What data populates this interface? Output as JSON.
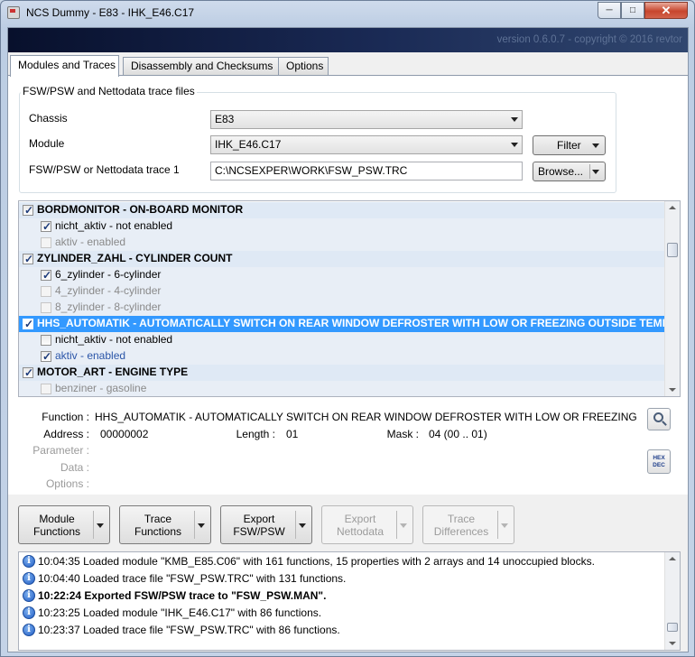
{
  "window": {
    "title": "NCS Dummy - E83 - IHK_E46.C17",
    "minimize_glyph": "─",
    "maximize_glyph": "□",
    "close_glyph": "✕"
  },
  "banner": {
    "version": "version 0.6.0.7 - copyright © 2016 revtor"
  },
  "tabs": [
    {
      "label": "Modules and Traces",
      "active": true
    },
    {
      "label": "Disassembly and Checksums",
      "active": false
    },
    {
      "label": "Options",
      "active": false
    }
  ],
  "files": {
    "group_title": "FSW/PSW and Nettodata trace files",
    "chassis_label": "Chassis",
    "chassis_value": "E83",
    "module_label": "Module",
    "module_value": "IHK_E46.C17",
    "trace_label": "FSW/PSW or Nettodata trace 1",
    "trace_value": "C:\\NCSEXPER\\WORK\\FSW_PSW.TRC",
    "filter_label": "Filter",
    "browse_label": "Browse..."
  },
  "functions": [
    {
      "kind": "group",
      "checked": true,
      "text": "BORDMONITOR  -  ON-BOARD MONITOR"
    },
    {
      "kind": "child",
      "checked": true,
      "dim": false,
      "text": "nicht_aktiv  -  not enabled"
    },
    {
      "kind": "child",
      "checked": false,
      "dim": true,
      "text": "aktiv  -  enabled"
    },
    {
      "kind": "group",
      "checked": true,
      "text": "ZYLINDER_ZAHL  -  CYLINDER COUNT"
    },
    {
      "kind": "child",
      "checked": true,
      "dim": false,
      "text": "6_zylinder  -  6-cylinder"
    },
    {
      "kind": "child",
      "checked": false,
      "dim": true,
      "text": "4_zylinder  -  4-cylinder"
    },
    {
      "kind": "child",
      "checked": false,
      "dim": true,
      "text": "8_zylinder  -  8-cylinder"
    },
    {
      "kind": "group",
      "checked": true,
      "selected": true,
      "text": "HHS_AUTOMATIK  -  AUTOMATICALLY SWITCH ON REAR WINDOW DEFROSTER WITH LOW OR FREEZING OUTSIDE TEMPERA"
    },
    {
      "kind": "child",
      "checked": false,
      "dim": false,
      "text": "nicht_aktiv  -  not enabled"
    },
    {
      "kind": "child",
      "checked": true,
      "dim": false,
      "blue": true,
      "text": "aktiv  -  enabled"
    },
    {
      "kind": "group",
      "checked": true,
      "text": "MOTOR_ART  -  ENGINE TYPE"
    },
    {
      "kind": "child",
      "checked": false,
      "dim": true,
      "text": "benziner  -  gasoline"
    }
  ],
  "details": {
    "function_label": "Function :",
    "function_value": "HHS_AUTOMATIK  -  AUTOMATICALLY SWITCH ON REAR WINDOW DEFROSTER WITH LOW OR FREEZING OUTSIDE",
    "address_label": "Address :",
    "address_value": "00000002",
    "length_label": "Length :",
    "length_value": "01",
    "mask_label": "Mask :",
    "mask_value": "04  (00 .. 01)",
    "parameter_label": "Parameter :",
    "data_label": "Data :",
    "options_label": "Options :",
    "hex_label": "HEX",
    "dec_label": "DEC"
  },
  "actions": [
    {
      "line1": "Module",
      "line2": "Functions",
      "enabled": true
    },
    {
      "line1": "Trace",
      "line2": "Functions",
      "enabled": true
    },
    {
      "line1": "Export",
      "line2": "FSW/PSW",
      "enabled": true
    },
    {
      "line1": "Export",
      "line2": "Nettodata",
      "enabled": false
    },
    {
      "line1": "Trace",
      "line2": "Differences",
      "enabled": false
    }
  ],
  "log": [
    {
      "time": "10:04:35",
      "text": "Loaded module \"KMB_E85.C06\" with 161 functions, 15 properties with 2 arrays and 14 unoccupied blocks.",
      "bold": false
    },
    {
      "time": "10:04:40",
      "text": "Loaded trace file \"FSW_PSW.TRC\" with 131 functions.",
      "bold": false
    },
    {
      "time": "10:22:24",
      "text": "Exported FSW/PSW trace to \"FSW_PSW.MAN\".",
      "bold": true
    },
    {
      "time": "10:23:25",
      "text": "Loaded module \"IHK_E46.C17\" with 86 functions.",
      "bold": false
    },
    {
      "time": "10:23:37",
      "text": "Loaded trace file \"FSW_PSW.TRC\" with 86 functions.",
      "bold": false
    }
  ],
  "colors": {
    "selection": "#3399ff",
    "group_row_bg": "#dfe9f5",
    "banner_dark": "#08102c",
    "info_icon": "#1f5bc4"
  }
}
